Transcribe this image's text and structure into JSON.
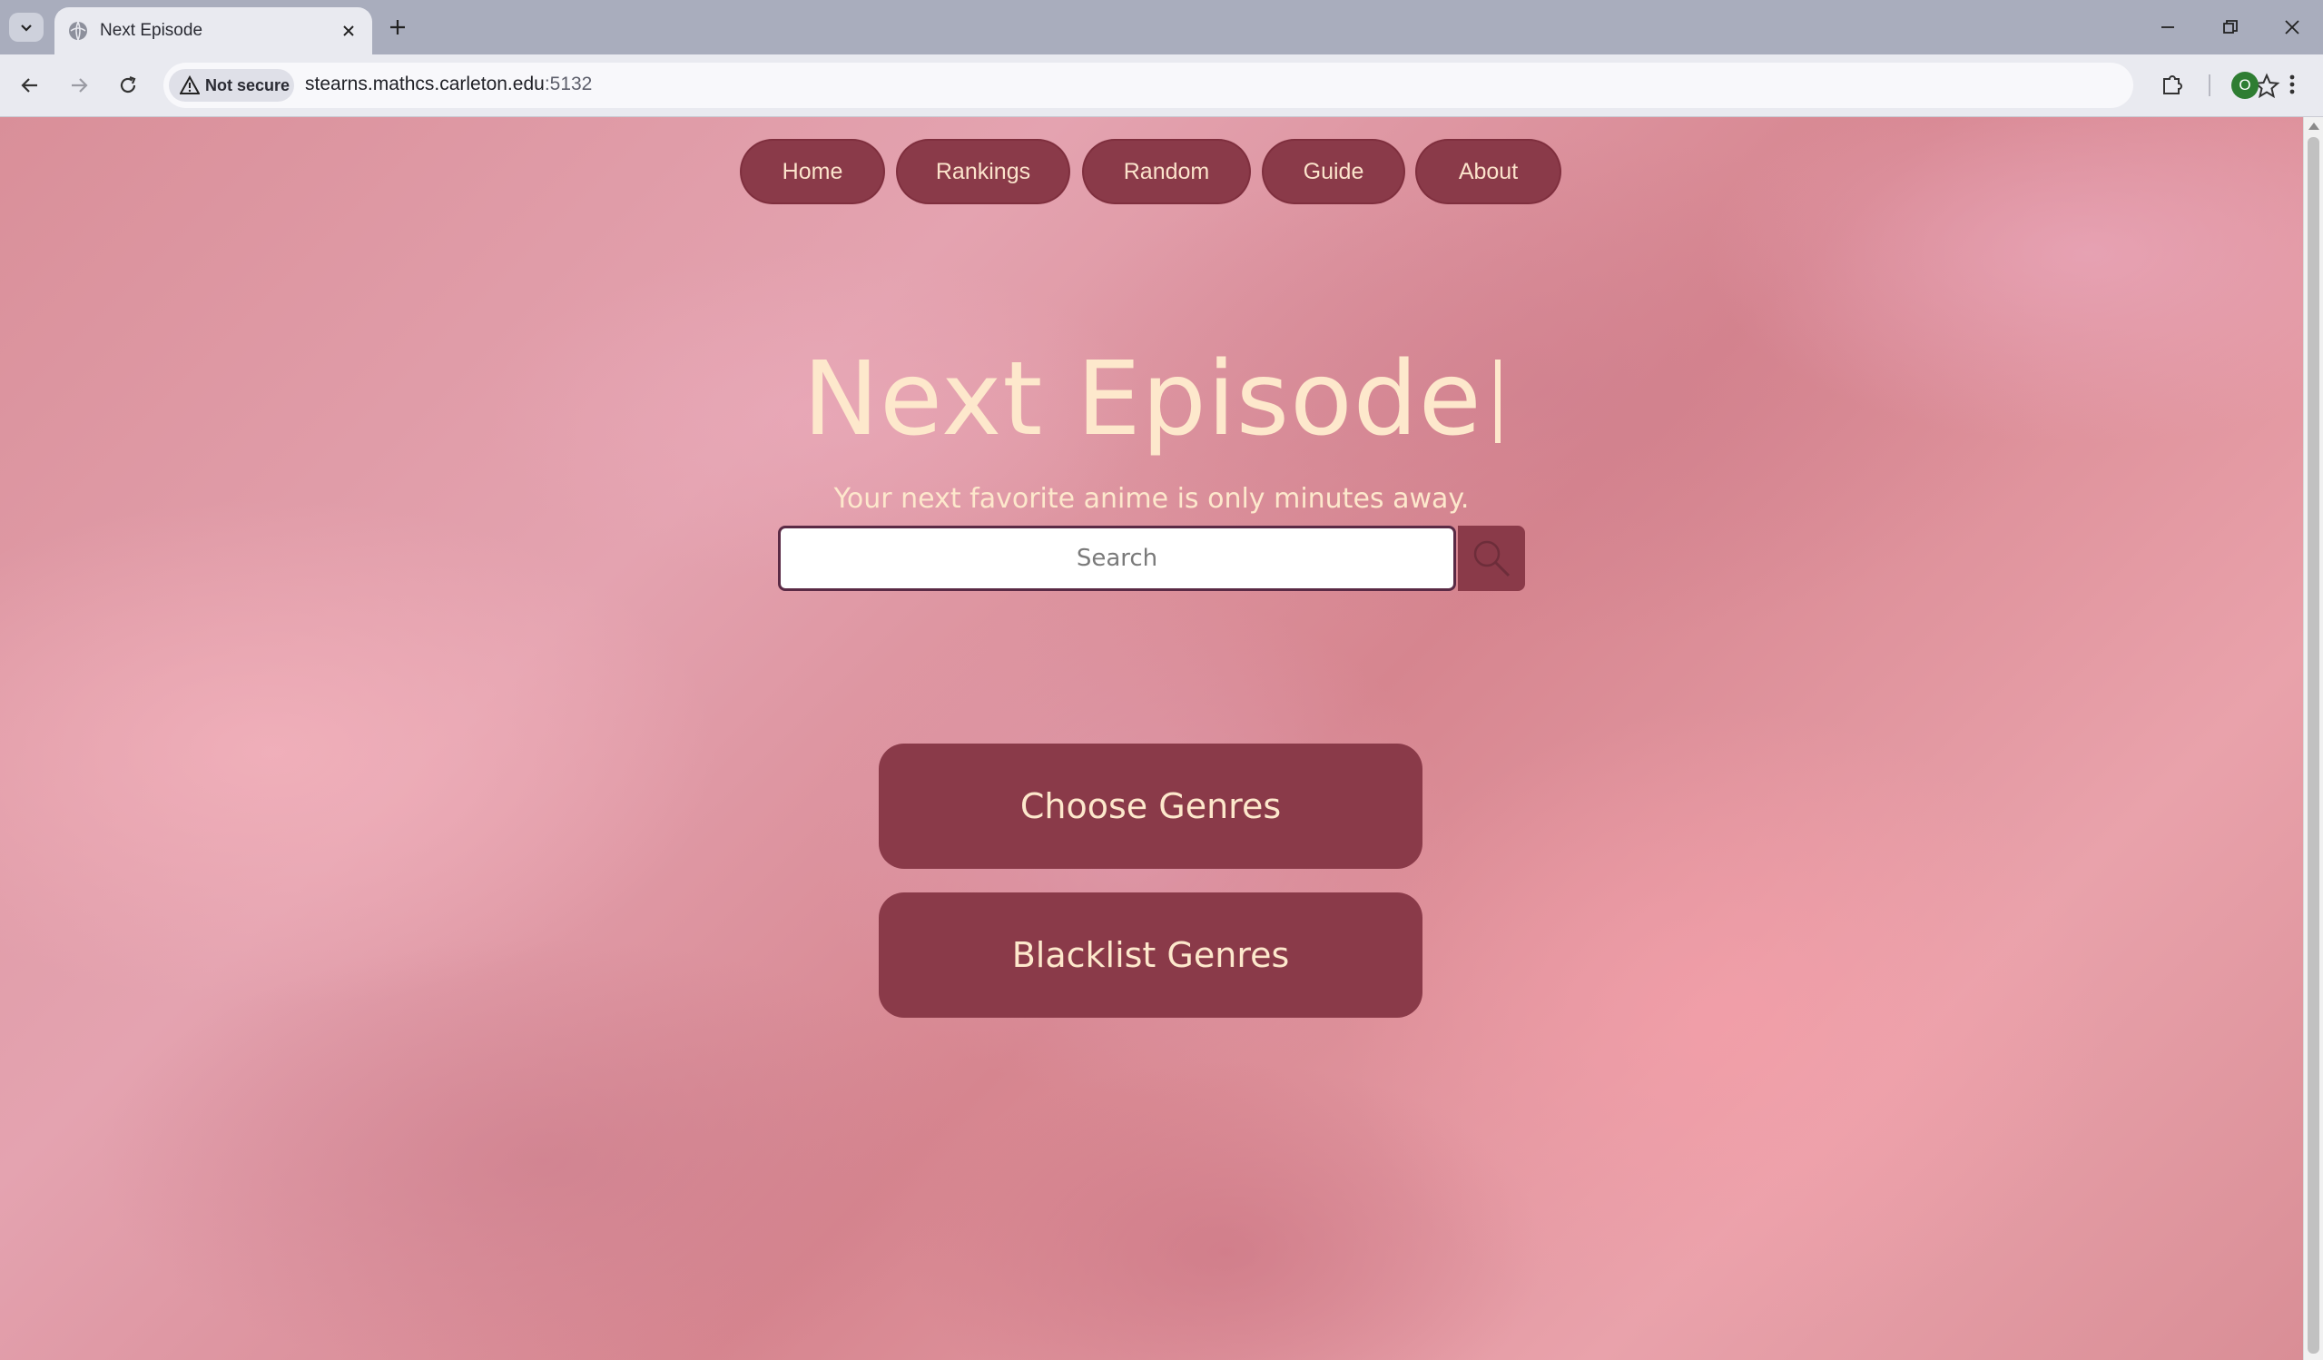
{
  "browser": {
    "tab_title": "Next Episode",
    "security_label": "Not secure",
    "url_host": "stearns.mathcs.carleton.edu",
    "url_port": ":5132",
    "profile_initial": "O"
  },
  "nav": {
    "items": [
      {
        "label": "Home"
      },
      {
        "label": "Rankings"
      },
      {
        "label": "Random"
      },
      {
        "label": "Guide"
      },
      {
        "label": "About"
      }
    ]
  },
  "hero": {
    "title": "Next Episode",
    "tagline": "Your next favorite anime is only minutes away."
  },
  "search": {
    "placeholder": "Search",
    "value": ""
  },
  "actions": {
    "choose_genres": "Choose Genres",
    "blacklist_genres": "Blacklist Genres"
  },
  "colors": {
    "accent": "#8a3a49",
    "text_cream": "#fde8cc",
    "tabbar": "#a9adbd",
    "toolbar": "#e9eaf0"
  },
  "icons": {
    "tab_search": "chevron-down-icon",
    "favicon": "globe-icon",
    "tab_close": "close-icon",
    "new_tab": "plus-icon",
    "minimize": "minimize-icon",
    "restore": "restore-icon",
    "window_close": "close-icon",
    "back": "arrow-left-icon",
    "forward": "arrow-right-icon",
    "reload": "reload-icon",
    "warning": "warning-icon",
    "bookmark": "star-icon",
    "extensions": "puzzle-icon",
    "menu": "kebab-icon",
    "search": "magnifier-icon"
  }
}
